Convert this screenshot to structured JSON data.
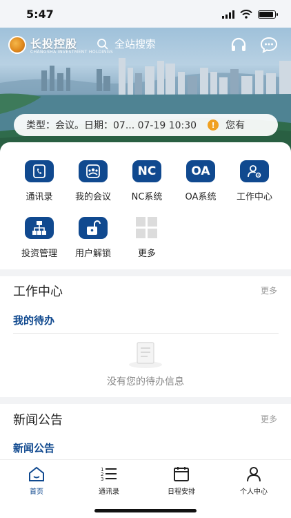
{
  "status_bar": {
    "time": "5:47"
  },
  "header": {
    "brand_name": "长投控股",
    "brand_subtitle": "CHANGSHA INVESTMENT HOLDINGS",
    "search_placeholder": "全站搜索"
  },
  "notice": {
    "text": "类型：会议。日期：07... 07-19 10:30",
    "trailing_text": "您有"
  },
  "apps": [
    {
      "label": "通讯录",
      "icon": "contacts-icon"
    },
    {
      "label": "我的会议",
      "icon": "meeting-icon"
    },
    {
      "label": "NC系统",
      "icon": "nc-icon",
      "glyph": "NC"
    },
    {
      "label": "OA系统",
      "icon": "oa-icon",
      "glyph": "OA"
    },
    {
      "label": "工作中心",
      "icon": "user-settings-icon"
    },
    {
      "label": "投资管理",
      "icon": "org-chart-icon"
    },
    {
      "label": "用户解锁",
      "icon": "unlock-icon"
    },
    {
      "label": "更多",
      "icon": "more-grid-icon"
    }
  ],
  "work_center": {
    "title": "工作中心",
    "more": "更多",
    "tab": "我的待办",
    "empty_text": "没有您的待办信息"
  },
  "news": {
    "title": "新闻公告",
    "more": "更多",
    "tab": "新闻公告"
  },
  "tabbar": [
    {
      "label": "首页",
      "icon": "home-icon",
      "active": true
    },
    {
      "label": "通讯录",
      "icon": "list-icon",
      "active": false
    },
    {
      "label": "日程安排",
      "icon": "calendar-icon",
      "active": false
    },
    {
      "label": "个人中心",
      "icon": "person-icon",
      "active": false
    }
  ],
  "colors": {
    "primary": "#10498f",
    "divider": "#f2f3f5",
    "warning": "#f0a020"
  }
}
